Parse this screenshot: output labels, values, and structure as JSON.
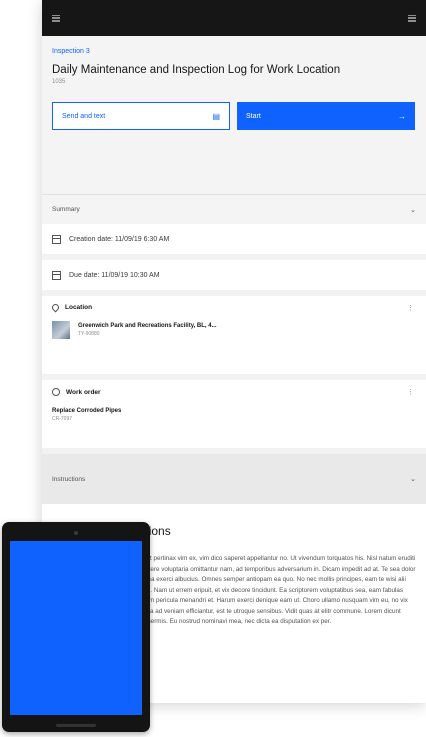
{
  "header": {
    "breadcrumb": "Inspection 3",
    "title": "Daily Maintenance and Inspection Log for Work Location",
    "subtitle": "1035"
  },
  "actions": {
    "send_label": "Send and text",
    "start_label": "Start"
  },
  "summary": {
    "label": "Summary",
    "creation_date": "Creation date: 11/09/19 6:30 AM",
    "due_date": "Due date: 11/09/19 10:30 AM"
  },
  "location": {
    "label": "Location",
    "name": "Greenwich Park and Recreations Facility, BL, 4...",
    "id": "TY-90880"
  },
  "work_order": {
    "label": "Work order",
    "title": "Replace Corroded Pipes",
    "id": "CR-7097"
  },
  "instructions": {
    "label": "Instructions",
    "title": "Follow the instructions",
    "text": "Lorem ipsum dolor sit amet, impedit pertinax vim ex, vim dico saperet appellantur no. Ut vivendum torquatos his. Nisl natum eruditi ea vix. Quem epicuri vix te, in oportere voluptaria omittantur nam, ad temporibus adversarium in. Dicam impedit ad at. Te sea dolor graeci, sea eu movet ornatus, per ea exerci albucius. Omnes semper antiopam ea quo. No nec mollis principes, eam te wisi alii per, vel feugiat sanctus minimum id. Nam ut errem eripuit, et vix decore tincidunt. Ea scriptorem voluptatibus sea, eam fabulas adipisci philosophia cu. Elit accusam pericula menandri et. Harum exerci denique eam ut. Choro ullamo nusquam vim eu, no vix aliquam legendi expetendis eam. Ea ad veniam efficiantur, est te utroque sensibus. Vidit quas at elitr commune. Lorem dicunt sanctus et vel. Ea omnis impetus inermis. Eu nostrud nominavi mea, nec dicta ea disputation ex per."
  },
  "colors": {
    "accent": "#0f62fe",
    "topbar": "#161616"
  }
}
